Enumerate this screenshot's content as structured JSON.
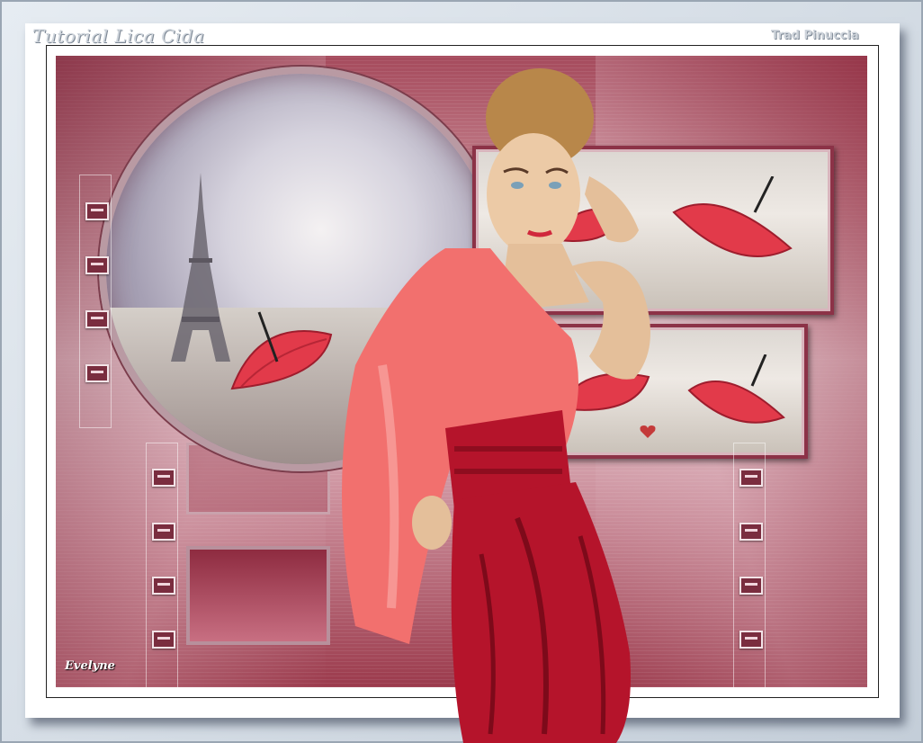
{
  "watermarks": {
    "top_left": "Tutorial Lica Cida",
    "top_right": "Trad Pinuccia",
    "signature": "Evelyne"
  },
  "colors": {
    "frame_bg": "#d3dbe4",
    "accent_burgundy": "#8c3247",
    "dress_red": "#b5142b",
    "blouse_coral": "#f2706e",
    "umbrella_red": "#e23a4a"
  },
  "scene": {
    "subject": "woman-in-red-dress",
    "background_motifs": [
      "eiffel-tower-icon",
      "red-umbrella-icon",
      "heart-icon"
    ]
  }
}
